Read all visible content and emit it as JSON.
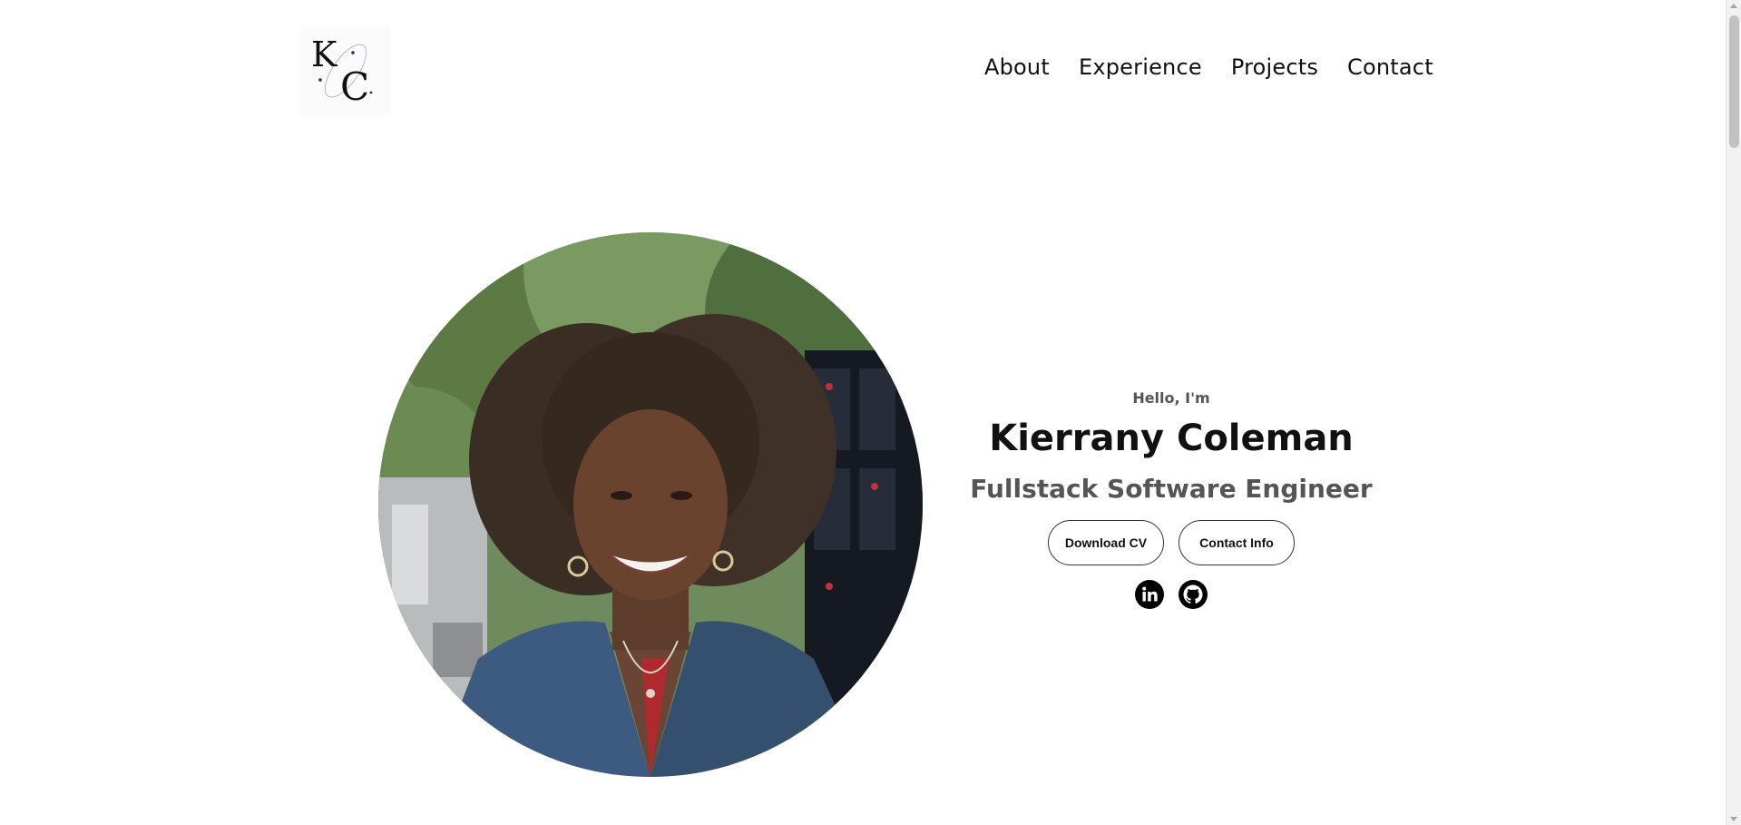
{
  "logo": {
    "letters": "KC",
    "icon": "kc-monogram-icon"
  },
  "nav": {
    "items": [
      {
        "label": "About"
      },
      {
        "label": "Experience"
      },
      {
        "label": "Projects"
      },
      {
        "label": "Contact"
      }
    ]
  },
  "hero": {
    "greeting": "Hello, I'm",
    "name": "Kierrany Coleman",
    "role": "Fullstack Software Engineer",
    "buttons": {
      "download": "Download CV",
      "contact": "Contact Info"
    },
    "socials": [
      {
        "icon": "linkedin-icon"
      },
      {
        "icon": "github-icon"
      }
    ],
    "portrait_icon": "profile-photo"
  },
  "colors": {
    "text": "#111111",
    "muted": "#555555",
    "background": "#ffffff",
    "button_border": "#333333"
  }
}
